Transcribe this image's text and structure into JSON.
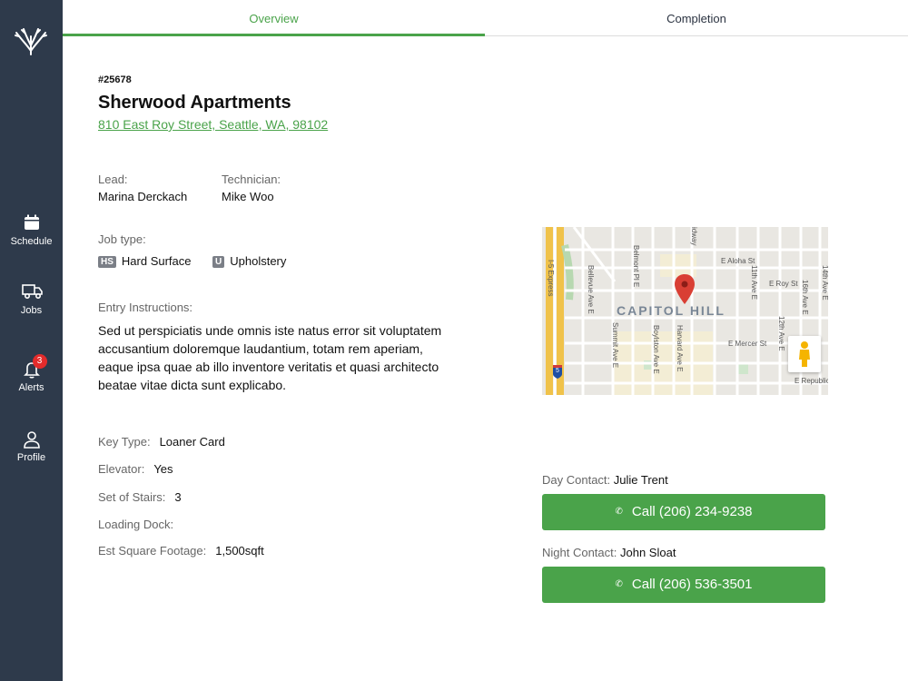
{
  "nav": {
    "items": [
      {
        "label": "Schedule",
        "icon": "calendar-icon"
      },
      {
        "label": "Jobs",
        "icon": "truck-icon"
      },
      {
        "label": "Alerts",
        "icon": "bell-icon",
        "badge": "3"
      },
      {
        "label": "Profile",
        "icon": "user-icon"
      }
    ]
  },
  "tabs": [
    {
      "label": "Overview",
      "active": true
    },
    {
      "label": "Completion",
      "active": false
    }
  ],
  "job": {
    "id": "#25678",
    "title": "Sherwood Apartments",
    "address": "810 East Roy Street, Seattle, WA, 98102",
    "lead_label": "Lead:",
    "lead": "Marina Derckach",
    "technician_label": "Technician:",
    "technician": "Mike Woo",
    "job_type_label": "Job type:",
    "job_types": [
      {
        "code": "HS",
        "label": "Hard Surface"
      },
      {
        "code": "U",
        "label": "Upholstery"
      }
    ],
    "entry_label": "Entry Instructions:",
    "entry_text": "Sed ut perspiciatis unde omnis iste natus error sit voluptatem accusantium doloremque laudantium, totam rem aperiam, eaque ipsa quae ab illo inventore veritatis et quasi architecto beatae vitae dicta sunt explicabo.",
    "details": [
      {
        "label": "Key Type:",
        "value": "Loaner Card"
      },
      {
        "label": "Elevator:",
        "value": "Yes"
      },
      {
        "label": "Set of Stairs:",
        "value": "3"
      },
      {
        "label": "Loading Dock:",
        "value": ""
      },
      {
        "label": "Est Square Footage:",
        "value": "1,500sqft"
      }
    ]
  },
  "map": {
    "neighborhood": "CAPITOL HILL",
    "streets": [
      "E Aloha St",
      "E Roy St",
      "E Mercer St",
      "E Republic",
      "I-5 Express",
      "Bellevue Ave E",
      "Belmont Pl E",
      "Summit Ave E",
      "Boylston Ave E",
      "Harvard Ave E",
      "11th Ave E",
      "12th Ave E",
      "14th Ave E",
      "16th Ave E",
      "idway",
      "5"
    ]
  },
  "contacts": {
    "day_label": "Day Contact:",
    "day_name": "Julie Trent",
    "day_button": "Call (206) 234-9238",
    "night_label": "Night Contact:",
    "night_name": "John Sloat",
    "night_button": "Call (206) 536-3501"
  },
  "colors": {
    "sidebar": "#2e3a4b",
    "accent": "#4aa34a",
    "badge": "#e32b2b"
  }
}
